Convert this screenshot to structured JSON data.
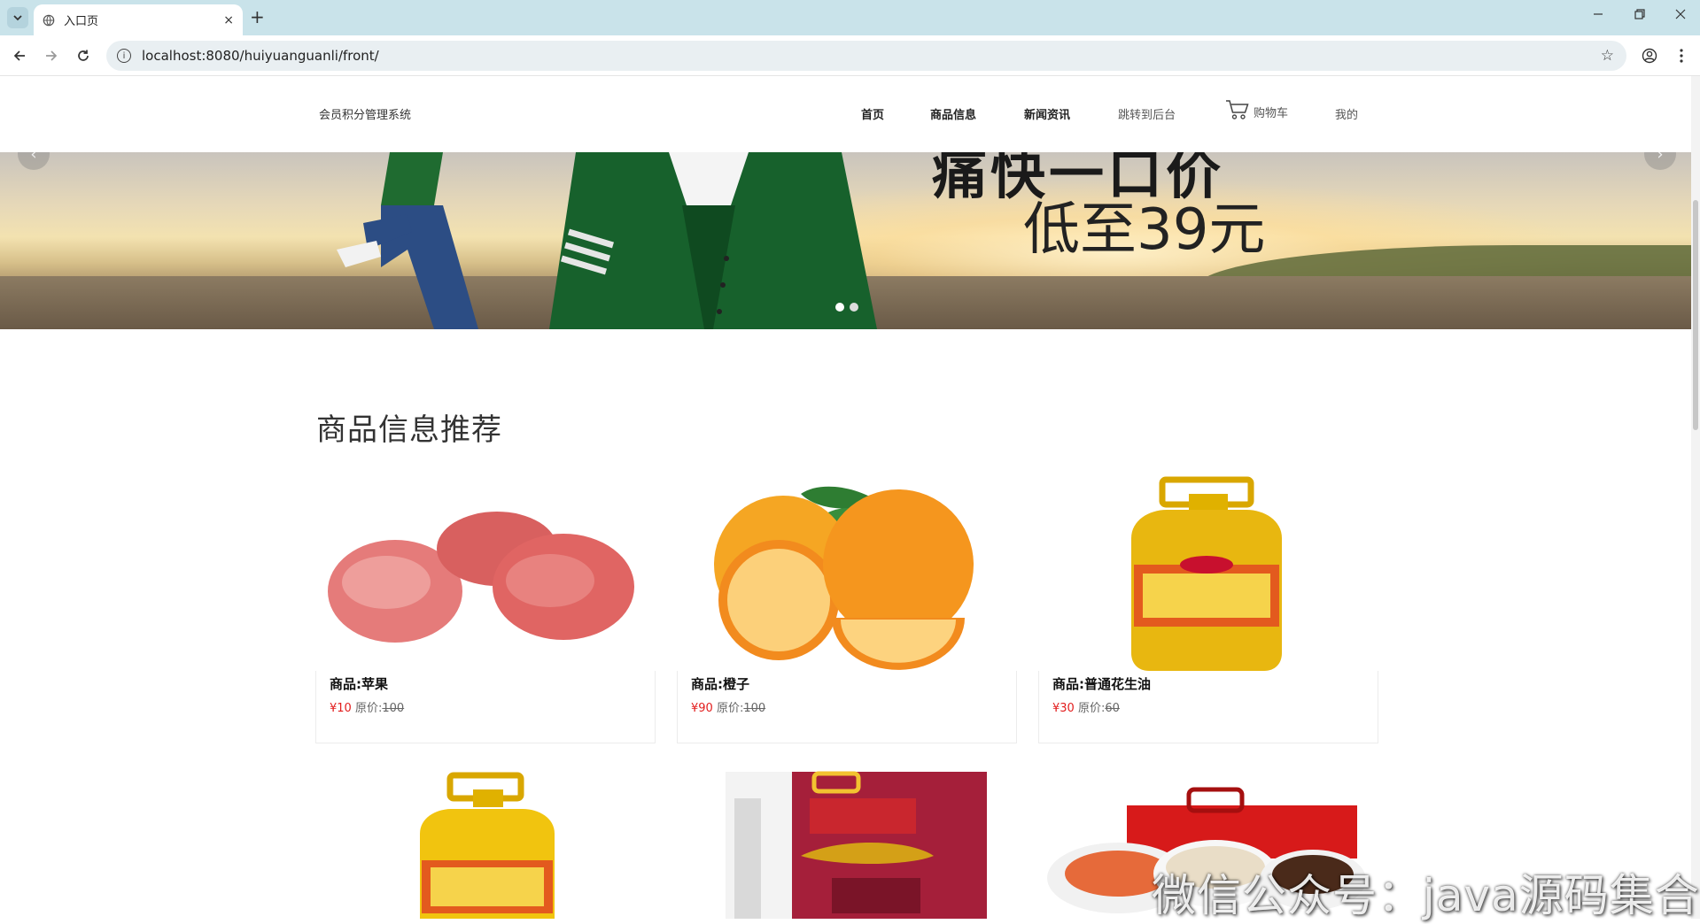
{
  "browser": {
    "tab_title": "入口页",
    "url": "localhost:8080/huiyuanguanli/front/",
    "new_tab": "+",
    "close": "×"
  },
  "header": {
    "brand": "会员积分管理系统",
    "nav": [
      "首页",
      "商品信息",
      "新闻资讯",
      "跳转到后台",
      "购物车",
      "我的"
    ]
  },
  "banner": {
    "headline_top": "痛快一口价",
    "headline_price": "低至39元",
    "slide_count": 2,
    "active_slide": 1
  },
  "section": {
    "title": "商品信息推荐"
  },
  "products": [
    {
      "name": "商品:苹果",
      "price": "¥10",
      "orig_label": "原价:",
      "orig_price": "100",
      "icon": "apple-image"
    },
    {
      "name": "商品:橙子",
      "price": "¥90",
      "orig_label": "原价:",
      "orig_price": "100",
      "icon": "orange-image"
    },
    {
      "name": "商品:普通花生油",
      "price": "¥30",
      "orig_label": "原价:",
      "orig_price": "60",
      "icon": "oil-bottle-image"
    },
    {
      "name": "",
      "price": "",
      "orig_label": "",
      "orig_price": "",
      "icon": "oil-bottle-image"
    },
    {
      "name": "",
      "price": "",
      "orig_label": "",
      "orig_price": "",
      "icon": "rice-bag-image"
    },
    {
      "name": "",
      "price": "",
      "orig_label": "",
      "orig_price": "",
      "icon": "gift-box-image"
    }
  ],
  "watermark": "微信公众号：java源码集合",
  "colors": {
    "price": "#e21d1d",
    "tabbar": "#c9e3ea"
  }
}
